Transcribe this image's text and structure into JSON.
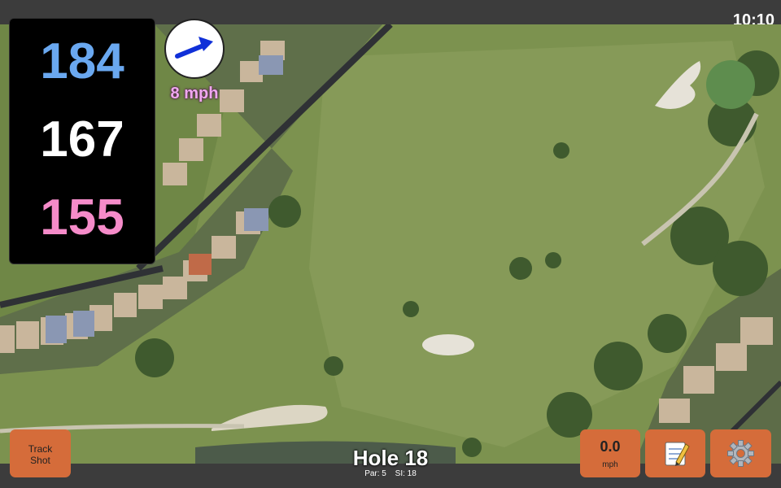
{
  "status_bar": {
    "time": "10:10"
  },
  "distances": {
    "back": "184",
    "middle": "167",
    "front": "155"
  },
  "wind": {
    "speed": "8 mph",
    "direction_icon": "arrow-east-northeast-icon"
  },
  "hole": {
    "title": "Hole 18",
    "par": "Par: 5",
    "si": "SI: 18"
  },
  "buttons": {
    "track_shot_line1": "Track",
    "track_shot_line2": "Shot",
    "speed_value": "0.0",
    "speed_unit": "mph",
    "notes_icon": "notepad-icon",
    "settings_icon": "gear-icon"
  },
  "colors": {
    "back_distance": "#6aa8f0",
    "middle_distance": "#ffffff",
    "front_distance": "#f58bc9",
    "button_bg": "#d56c3a",
    "wind_text": "#f0a8f0"
  }
}
